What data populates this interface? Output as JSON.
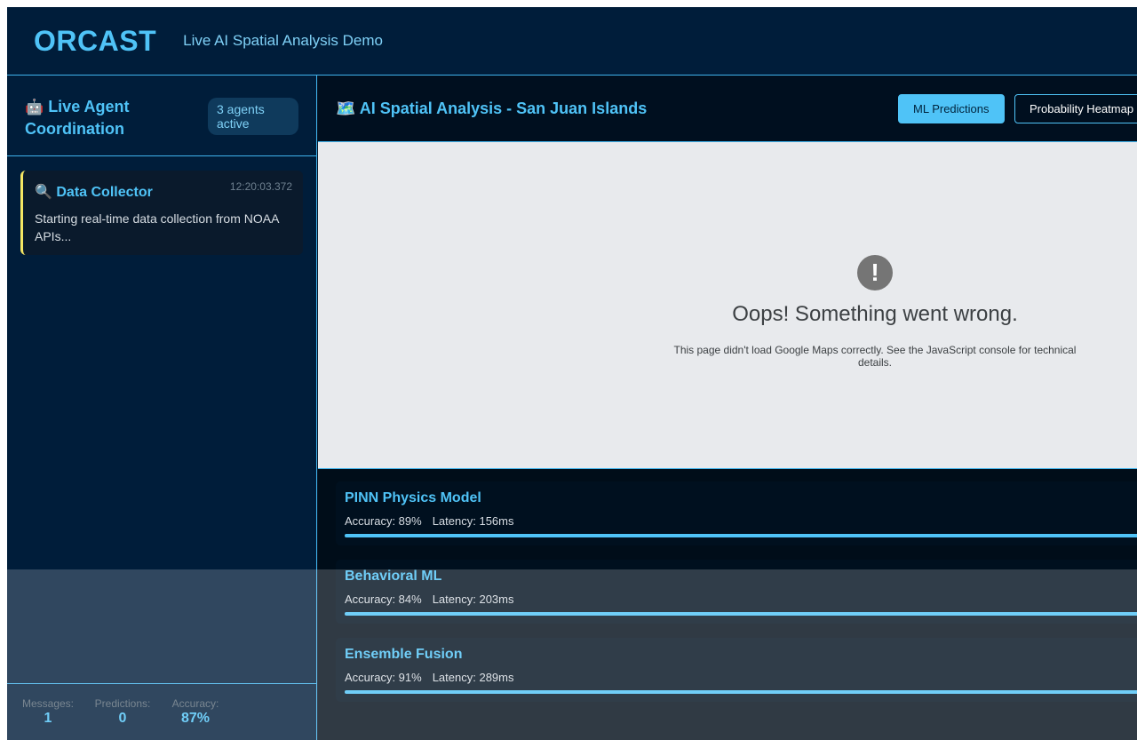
{
  "header": {
    "brand": "ORCAST",
    "subtitle": "Live AI Spatial Analysis Demo"
  },
  "sidebar": {
    "title_icon": "🤖",
    "title": "Live Agent Coordination",
    "agents_badge": "3 agents active",
    "messages": [
      {
        "icon": "🔍",
        "agent": "Data Collector",
        "time": "12:20:03.372",
        "text": "Starting real-time data collection from NOAA APIs...",
        "accent": "#f5e663"
      }
    ],
    "stats": {
      "messages_label": "Messages:",
      "messages_value": "1",
      "predictions_label": "Predictions:",
      "predictions_value": "0",
      "accuracy_label": "Accuracy:",
      "accuracy_value": "87%"
    }
  },
  "main": {
    "title_icon": "🗺️",
    "title": "AI Spatial Analysis - San Juan Islands",
    "buttons": {
      "ml_predictions": "ML Predictions",
      "probability_heatmap": "Probability Heatmap"
    },
    "map_error": {
      "icon": "!",
      "title": "Oops! Something went wrong.",
      "text": "This page didn't load Google Maps correctly. See the JavaScript console for technical details."
    },
    "models": [
      {
        "name": "PINN Physics Model",
        "accuracy": "Accuracy: 89%",
        "latency": "Latency: 156ms",
        "progress": 1.0
      },
      {
        "name": "Behavioral ML",
        "accuracy": "Accuracy: 84%",
        "latency": "Latency: 203ms",
        "progress": 1.0
      },
      {
        "name": "Ensemble Fusion",
        "accuracy": "Accuracy: 91%",
        "latency": "Latency: 289ms",
        "progress": 1.0
      }
    ]
  },
  "colors": {
    "accent": "#4fc3f7",
    "background": "#001d3a",
    "message_accent": "#f5e663"
  }
}
